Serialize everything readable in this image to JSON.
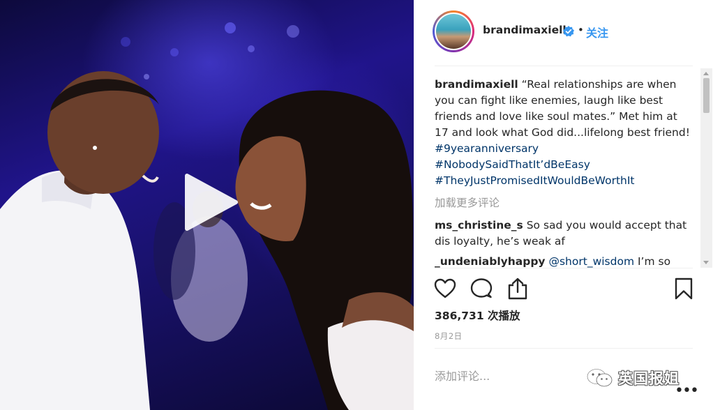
{
  "post": {
    "username": "brandimaxiell",
    "separator": "•",
    "follow_label": "关注"
  },
  "caption": {
    "username": "brandimaxiell",
    "text": "“Real relationships are when you can fight like enemies, laugh like best friends and love like soul mates.” Met him at 17 and look what God did...lifelong best friend!",
    "hashtags": [
      "#9yearanniversary",
      "#NobodySaidThatIt’dBeEasy",
      "#TheyJustPromisedItWouldBeWorthIt"
    ]
  },
  "load_more_label": "加载更多评论",
  "comments": [
    {
      "username": "ms_christine_s",
      "text": "So sad you would accept that dis loyalty, he’s weak af"
    },
    {
      "username": "_undeniablyhappy",
      "mention": "@short_wisdom",
      "text": "I’m so"
    }
  ],
  "stats": {
    "views_count": "386,731",
    "views_label": "次播放",
    "date": "8月2日"
  },
  "add_comment_placeholder": "添加评论...",
  "watermark": {
    "text": "英国报姐"
  },
  "more_menu_label": "•••",
  "icons": {
    "like": "heart-icon",
    "comment": "comment-icon",
    "share": "share-icon",
    "save": "bookmark-icon",
    "play": "play-icon",
    "verified": "verified-badge-icon"
  },
  "colors": {
    "link": "#003569",
    "follow": "#3897f0",
    "verified": "#3897f0",
    "muted": "#999999"
  }
}
